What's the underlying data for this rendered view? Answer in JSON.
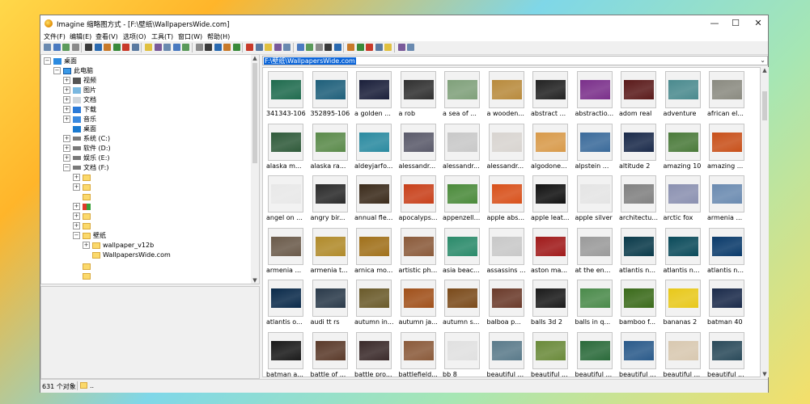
{
  "window": {
    "title": "Imagine 缩略图方式 - [F:\\壁纸\\WallpapersWide.com]",
    "controls": {
      "minimize": "—",
      "maximize": "☐",
      "close": "✕"
    }
  },
  "menu": [
    "文件(F)",
    "编辑(E)",
    "查看(V)",
    "选项(O)",
    "工具(T)",
    "窗口(W)",
    "帮助(H)"
  ],
  "toolbar_icons": [
    "open-icon",
    "browse-icon",
    "save-icon",
    "save-all-icon",
    "print-icon",
    "info-icon",
    "image-icon",
    "folder-image-icon",
    "delete-icon",
    "copy-icon",
    "page-icon",
    "cut-icon",
    "copy-doc-icon",
    "paste-icon",
    "undo-icon",
    "view-thumb-icon",
    "view-detail-icon",
    "calendar-icon",
    "tree-icon",
    "view-list-icon",
    "view-small-icon",
    "view-large-icon",
    "folder-up-icon",
    "refresh-icon",
    "grid-icon",
    "grid2-icon",
    "grid3-icon",
    "grid4-icon",
    "grid5-icon",
    "tools-icon",
    "convert-icon",
    "batch-icon",
    "slideshow-icon",
    "capture-icon",
    "edit-icon",
    "options-icon",
    "help-icon"
  ],
  "tree": {
    "desktop": "桌面",
    "this_pc": "此电脑",
    "videos": "视频",
    "pictures": "图片",
    "documents": "文档",
    "downloads": "下载",
    "music": "音乐",
    "desktop2": "桌面",
    "drive_c": "系统 (C:)",
    "drive_d": "软件 (D:)",
    "drive_e": "娱乐 (E:)",
    "drive_f": "文档 (F:)",
    "wallpaper": "壁纸",
    "wallpaper_v12b": "wallpaper_v12b",
    "wallpaperswide": "WallpapersWide.com"
  },
  "address": {
    "path": "F:\\壁纸\\WallpapersWide.com"
  },
  "thumbnails": [
    {
      "label": "341343-106",
      "color": "#1f6b4e"
    },
    {
      "label": "352895-106",
      "color": "#1e5f7a"
    },
    {
      "label": "a golden ...",
      "color": "#1a1f3a"
    },
    {
      "label": "a rob",
      "color": "#303030"
    },
    {
      "label": "a sea of ...",
      "color": "#7fa07a"
    },
    {
      "label": "a wooden...",
      "color": "#b88a3c"
    },
    {
      "label": "abstract ...",
      "color": "#222222"
    },
    {
      "label": "abstractio...",
      "color": "#7a2f8a"
    },
    {
      "label": "adom real",
      "color": "#5a1a1a"
    },
    {
      "label": "adventure",
      "color": "#4a8a8e"
    },
    {
      "label": "african el...",
      "color": "#8a8a80"
    },
    {
      "label": "alaska m...",
      "color": "#2f5a3a"
    },
    {
      "label": "alaska ra...",
      "color": "#5a8a4a"
    },
    {
      "label": "aldeyjarfo...",
      "color": "#2a8aa0"
    },
    {
      "label": "alessandr...",
      "color": "#5a5a6a"
    },
    {
      "label": "alessandr...",
      "color": "#c8c8c8"
    },
    {
      "label": "alessandr...",
      "color": "#d8d4d0"
    },
    {
      "label": "algodone...",
      "color": "#d89a4a"
    },
    {
      "label": "alpstein ...",
      "color": "#3a6a9a"
    },
    {
      "label": "altitude 2",
      "color": "#1a2a4a"
    },
    {
      "label": "amazing 10",
      "color": "#4a7a3a"
    },
    {
      "label": "amazing ...",
      "color": "#c8501a"
    },
    {
      "label": "angel on ...",
      "color": "#e8e8e8"
    },
    {
      "label": "angry bir...",
      "color": "#2a2a2a"
    },
    {
      "label": "annual fle...",
      "color": "#3a2a1a"
    },
    {
      "label": "apocalyps...",
      "color": "#c8401a"
    },
    {
      "label": "appenzell...",
      "color": "#4a8a3a"
    },
    {
      "label": "apple abs...",
      "color": "#d8501a"
    },
    {
      "label": "apple leat...",
      "color": "#111111"
    },
    {
      "label": "apple silver",
      "color": "#e4e4e4"
    },
    {
      "label": "architectu...",
      "color": "#808080"
    },
    {
      "label": "arctic fox",
      "color": "#8a90b0"
    },
    {
      "label": "armenia ...",
      "color": "#6a8ab0"
    },
    {
      "label": "armenia ...",
      "color": "#6a5a4a"
    },
    {
      "label": "armenia t...",
      "color": "#b08a2a"
    },
    {
      "label": "arnica mo...",
      "color": "#a0701a"
    },
    {
      "label": "artistic ph...",
      "color": "#8a5a3a"
    },
    {
      "label": "asia beac...",
      "color": "#2a8a6a"
    },
    {
      "label": "assassins ...",
      "color": "#c8c8c8"
    },
    {
      "label": "aston ma...",
      "color": "#a01a1a"
    },
    {
      "label": "at the en...",
      "color": "#9a9a9a"
    },
    {
      "label": "atlantis n...",
      "color": "#0a3a4a"
    },
    {
      "label": "atlantis n...",
      "color": "#0a4a5a"
    },
    {
      "label": "atlantis n...",
      "color": "#0a3a6a"
    },
    {
      "label": "atlantis o...",
      "color": "#0a2a4a"
    },
    {
      "label": "audi tt rs",
      "color": "#2a3a4a"
    },
    {
      "label": "autumn in...",
      "color": "#6a5a2a"
    },
    {
      "label": "autumn ja...",
      "color": "#a0501a"
    },
    {
      "label": "autumn s...",
      "color": "#7a4a1a"
    },
    {
      "label": "balboa p...",
      "color": "#6a3a2a"
    },
    {
      "label": "balls 3d 2",
      "color": "#1a1a1a"
    },
    {
      "label": "balls in q...",
      "color": "#4a8a4a"
    },
    {
      "label": "bamboo f...",
      "color": "#3a6a1a"
    },
    {
      "label": "bananas 2",
      "color": "#e8c81a"
    },
    {
      "label": "batman 40",
      "color": "#1a2a4a"
    },
    {
      "label": "batman a...",
      "color": "#1a1a1a"
    },
    {
      "label": "battle of ...",
      "color": "#5a3a2a"
    },
    {
      "label": "battle pro...",
      "color": "#3a2a2a"
    },
    {
      "label": "battlefield...",
      "color": "#8a5a3a"
    },
    {
      "label": "bb 8",
      "color": "#e0e0e0"
    },
    {
      "label": "beautiful ...",
      "color": "#5a7a8a"
    },
    {
      "label": "beautiful ...",
      "color": "#6a8a3a"
    },
    {
      "label": "beautiful ...",
      "color": "#2a6a3a"
    },
    {
      "label": "beautiful ...",
      "color": "#2a5a8a"
    },
    {
      "label": "beautiful ...",
      "color": "#d8c8b0"
    },
    {
      "label": "beautiful ...",
      "color": "#2a4a5a"
    }
  ],
  "status": {
    "count": "631 个对象",
    "path": ".."
  }
}
